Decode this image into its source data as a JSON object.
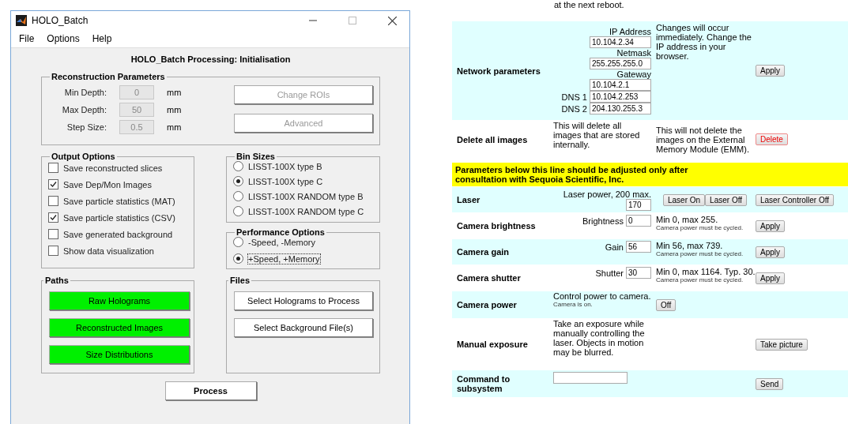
{
  "matlab_window": {
    "title": "HOLO_Batch",
    "menu": [
      "File",
      "Options",
      "Help"
    ],
    "heading": "HOLO_Batch Processing: Initialisation",
    "reconstruction": {
      "legend": "Reconstruction Parameters",
      "fields": [
        {
          "label": "Min Depth:",
          "value": "0",
          "unit": "mm",
          "disabled": true
        },
        {
          "label": "Max Depth:",
          "value": "50",
          "unit": "mm",
          "disabled": true
        },
        {
          "label": "Step Size:",
          "value": "0.5",
          "unit": "mm",
          "disabled": true
        }
      ],
      "buttons": [
        {
          "label": "Change ROIs",
          "disabled": true
        },
        {
          "label": "Advanced",
          "disabled": true
        }
      ]
    },
    "output_options": {
      "legend": "Output Options",
      "items": [
        {
          "label": "Save reconstructed slices",
          "checked": false
        },
        {
          "label": "Save Dep/Mon Images",
          "checked": true
        },
        {
          "label": "Save particle statistics (MAT)",
          "checked": false
        },
        {
          "label": "Save particle statistics (CSV)",
          "checked": true
        },
        {
          "label": "Save generated background",
          "checked": false
        },
        {
          "label": "Show data visualization",
          "checked": false
        }
      ]
    },
    "bin_sizes": {
      "legend": "Bin Sizes",
      "items": [
        {
          "label": "LISST-100X type B",
          "selected": false
        },
        {
          "label": "LISST-100X type C",
          "selected": true
        },
        {
          "label": "LISST-100X RANDOM type B",
          "selected": false
        },
        {
          "label": "LISST-100X RANDOM type C",
          "selected": false
        }
      ]
    },
    "performance_options": {
      "legend": "Performance Options",
      "items": [
        {
          "label": "-Speed, -Memory",
          "selected": false,
          "focused": false
        },
        {
          "label": "+Speed, +Memory",
          "selected": true,
          "focused": true
        }
      ]
    },
    "paths": {
      "legend": "Paths",
      "buttons": [
        "Raw Holograms",
        "Reconstructed Images",
        "Size Distributions"
      ]
    },
    "files": {
      "legend": "Files",
      "buttons": [
        "Select Holograms to Process",
        "Select Background File(s)"
      ]
    },
    "process_button": "Process"
  },
  "web_page": {
    "top_text": "at the next reboot.",
    "rows": [
      {
        "kind": "network",
        "label": "Network parameters",
        "fields": [
          {
            "label": "IP Address",
            "value": "10.104.2.34",
            "kind": "above"
          },
          {
            "label": "Netmask",
            "value": "255.255.255.0",
            "kind": "above"
          },
          {
            "label": "Gateway",
            "value": "10.104.2.1",
            "kind": "above"
          },
          {
            "label": "DNS 1",
            "value": "10.104.2.253",
            "kind": "beside"
          },
          {
            "label": "DNS 2",
            "value": "204.130.255.3",
            "kind": "beside"
          }
        ],
        "note": "Changes will occur immediately. Change the IP address in your browser.",
        "button": {
          "label": "Apply",
          "danger": false
        }
      },
      {
        "kind": "info",
        "label": "Delete all images",
        "description": "This will delete all images that are stored internally.",
        "note": "This will not delete the images on the External Memory Module (EMM).",
        "button": {
          "label": "Delete",
          "danger": true
        }
      },
      {
        "kind": "banner",
        "text": "Parameters below this line should be adjusted only after consultation with Sequoia Scientific, Inc."
      },
      {
        "kind": "laser",
        "label": "Laser",
        "field_label": "Laser power, 200 max.",
        "value": "170",
        "mid_buttons": [
          "Laser On",
          "Laser Off"
        ],
        "button": {
          "label": "Laser Controller Off",
          "danger": false
        }
      },
      {
        "kind": "setting",
        "label": "Camera brightness",
        "field_label": "Brightness",
        "value": "0",
        "note": "Min 0, max 255.",
        "subnote": "Camera power must be cycled.",
        "button": {
          "label": "Apply",
          "danger": false
        }
      },
      {
        "kind": "setting",
        "label": "Camera gain",
        "field_label": "Gain",
        "value": "56",
        "note": "Min 56, max 739.",
        "subnote": "Camera power must be cycled.",
        "button": {
          "label": "Apply",
          "danger": false
        }
      },
      {
        "kind": "setting",
        "label": "Camera shutter",
        "field_label": "Shutter",
        "value": "30",
        "note": "Min 0, max 1164. Typ. 30.",
        "subnote": "Camera power must be cycled.",
        "button": {
          "label": "Apply",
          "danger": false
        }
      },
      {
        "kind": "power",
        "label": "Camera power",
        "description": "Control power to camera.",
        "subnote": "Camera is on.",
        "note_button": "Off"
      },
      {
        "kind": "info",
        "label": "Manual exposure",
        "description": "Take an exposure while manually controlling the laser. Objects in motion may be blurred.",
        "button": {
          "label": "Take picture",
          "danger": false
        }
      },
      {
        "kind": "command",
        "label": "Command to subsystem",
        "button": {
          "label": "Send",
          "danger": false
        }
      }
    ]
  }
}
